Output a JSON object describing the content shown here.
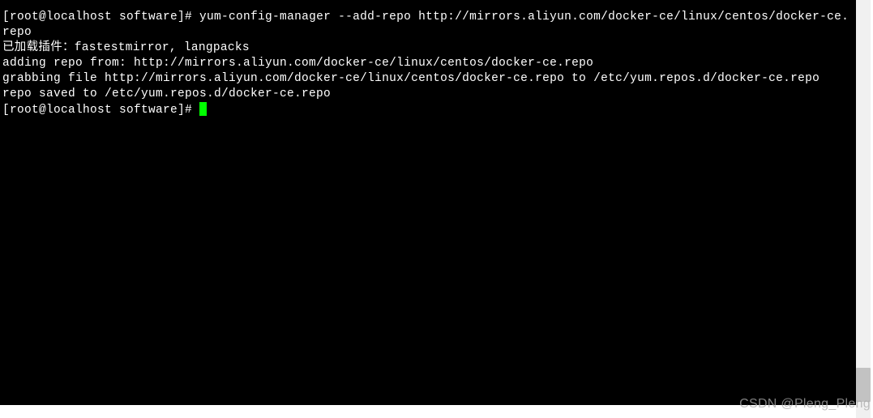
{
  "terminal": {
    "prompt1": "[root@localhost software]# ",
    "command1": "yum-config-manager --add-repo http://mirrors.aliyun.com/docker-ce/linux/centos/docker-ce.repo",
    "output": {
      "line1": "已加载插件：fastestmirror, langpacks",
      "line2": "adding repo from: http://mirrors.aliyun.com/docker-ce/linux/centos/docker-ce.repo",
      "line3": "grabbing file http://mirrors.aliyun.com/docker-ce/linux/centos/docker-ce.repo to /etc/yum.repos.d/docker-ce.repo",
      "line4": "repo saved to /etc/yum.repos.d/docker-ce.repo"
    },
    "prompt2": "[root@localhost software]# "
  },
  "watermark": "CSDN @Pleng_Pleng",
  "colors": {
    "background": "#000000",
    "text": "#ffffff",
    "cursor": "#00ff00"
  }
}
